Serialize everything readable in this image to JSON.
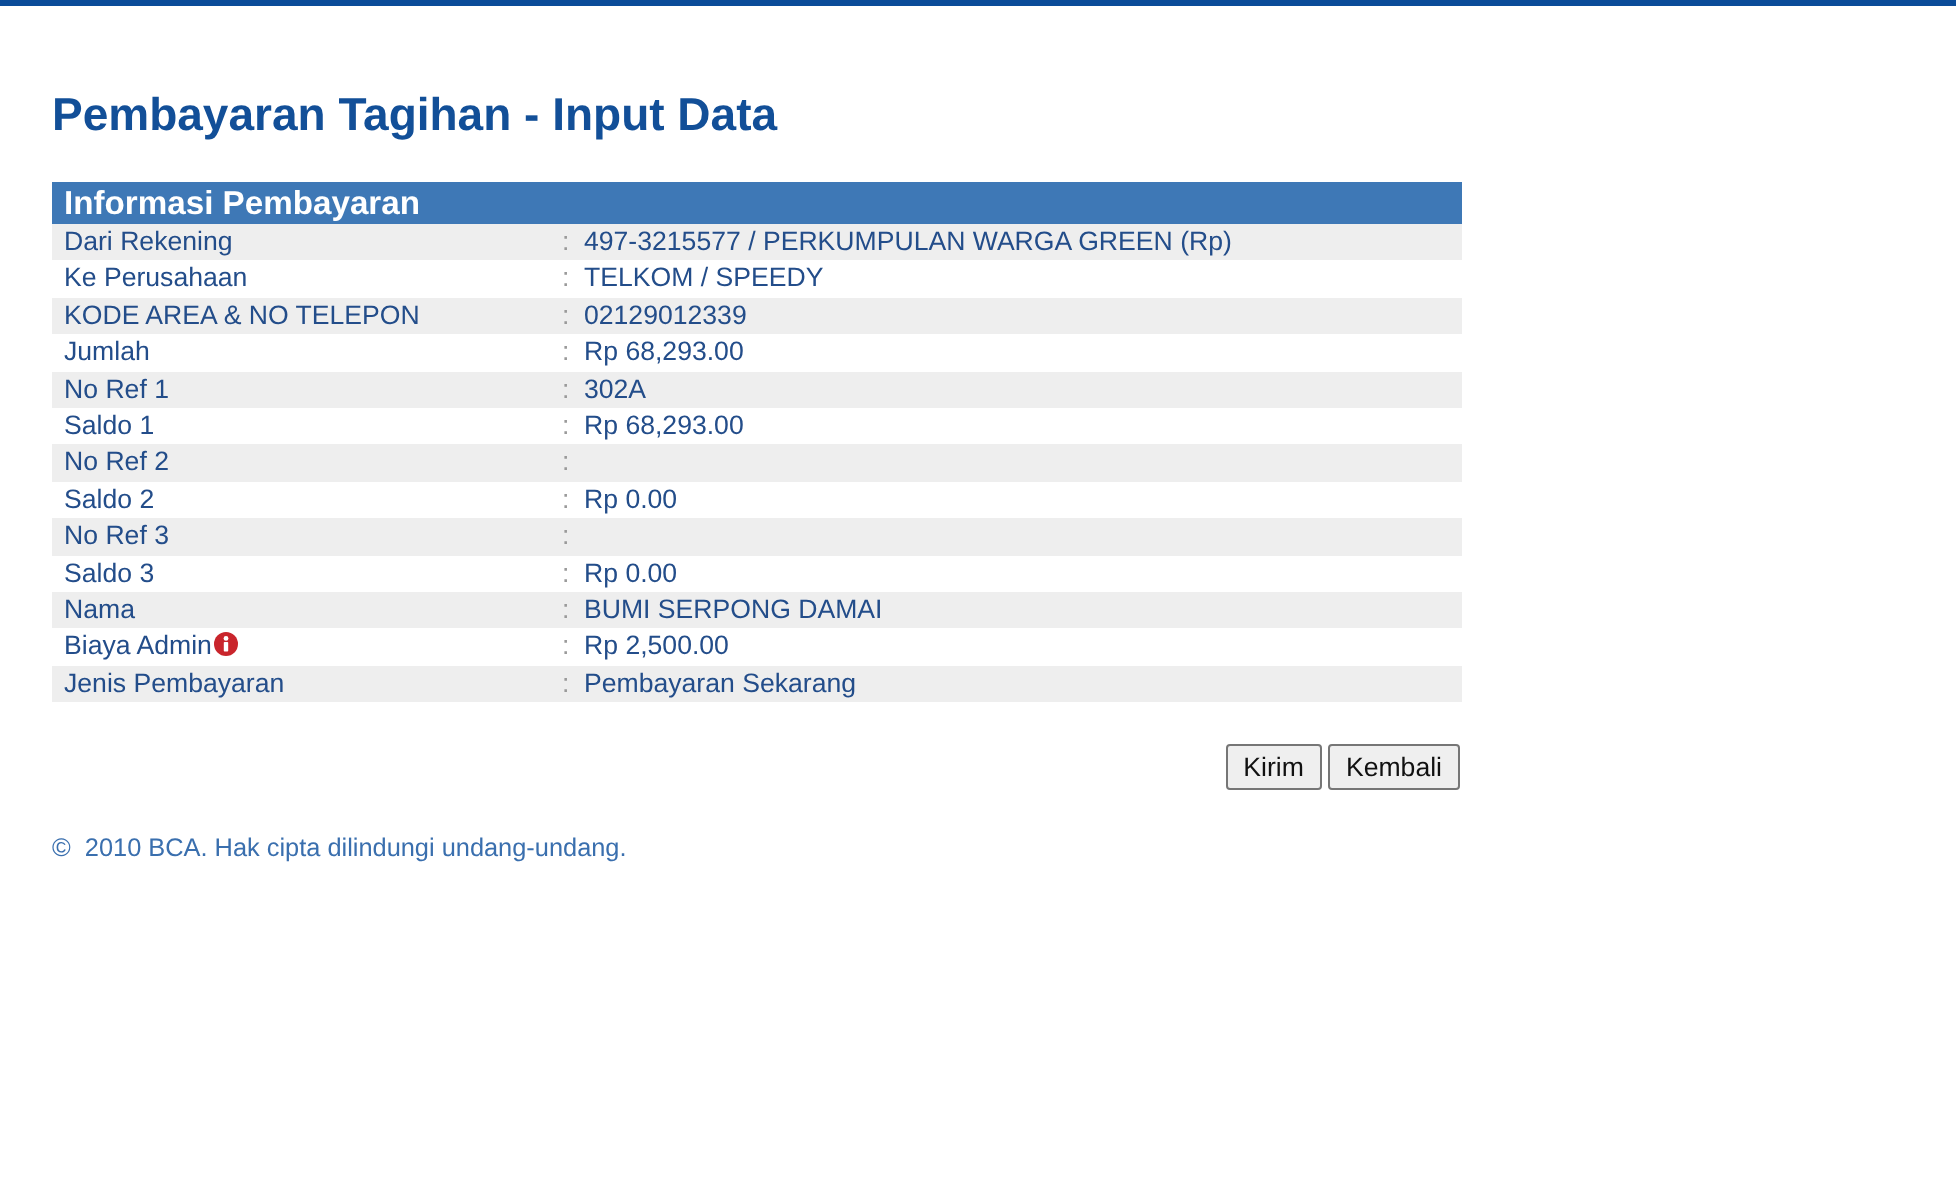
{
  "page": {
    "title": "Pembayaran Tagihan - Input Data"
  },
  "section": {
    "title": "Informasi Pembayaran",
    "rows": [
      {
        "label": "Dari Rekening",
        "separator": ":",
        "value": "497-3215577 / PERKUMPULAN WARGA GREEN (Rp)",
        "info_icon": false
      },
      {
        "label": "Ke Perusahaan",
        "separator": ":",
        "value": "TELKOM / SPEEDY",
        "info_icon": false
      },
      {
        "label": "KODE AREA & NO TELEPON",
        "separator": ":",
        "value": "02129012339",
        "info_icon": false
      },
      {
        "label": "Jumlah",
        "separator": ":",
        "value": "Rp 68,293.00",
        "info_icon": false
      },
      {
        "label": "No Ref 1",
        "separator": ":",
        "value": "302A",
        "info_icon": false
      },
      {
        "label": "Saldo 1",
        "separator": ":",
        "value": "Rp 68,293.00",
        "info_icon": false
      },
      {
        "label": "No Ref 2",
        "separator": ":",
        "info_icon": false
      },
      {
        "label": "Saldo 2",
        "separator": ":",
        "value": "Rp 0.00",
        "info_icon": false
      },
      {
        "label": "No Ref 3",
        "separator": ":",
        "info_icon": false
      },
      {
        "label": "Saldo 3",
        "separator": ":",
        "value": "Rp 0.00",
        "info_icon": false
      },
      {
        "label": "Nama",
        "separator": ":",
        "value": "BUMI SERPONG DAMAI",
        "info_icon": false
      },
      {
        "label": "Biaya Admin",
        "separator": ":",
        "value": "Rp 2,500.00",
        "info_icon": true
      },
      {
        "label": "Jenis Pembayaran",
        "separator": ":",
        "value": "Pembayaran Sekarang",
        "info_icon": false
      }
    ]
  },
  "buttons": [
    {
      "label": "Kirim"
    },
    {
      "label": "Kembali"
    }
  ],
  "footer": {
    "text": "©  2010 BCA. Hak cipta dilindungi undang-undang."
  }
}
